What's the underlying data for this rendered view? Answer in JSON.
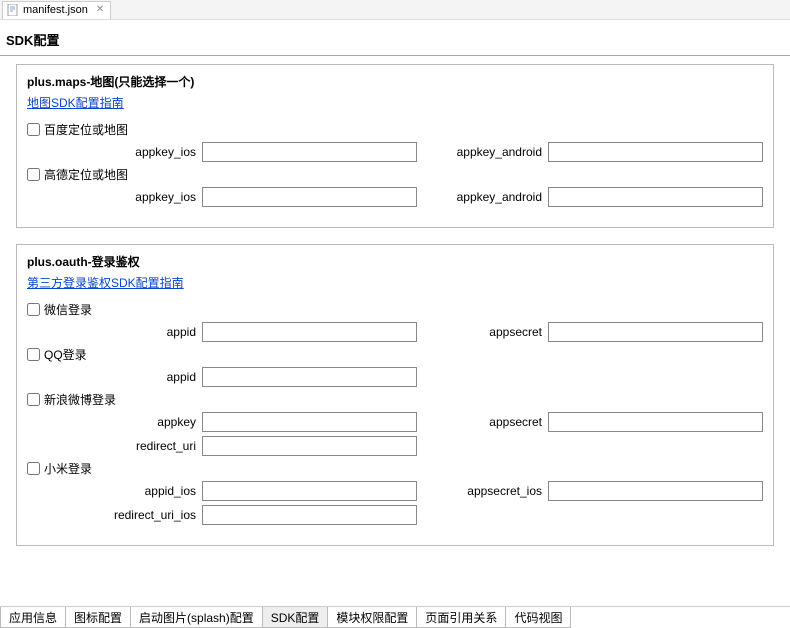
{
  "editor_tab": {
    "label": "manifest.json"
  },
  "page_title": "SDK配置",
  "panels": {
    "maps": {
      "title": "plus.maps-地图(只能选择一个)",
      "guide_link": "地图SDK配置指南",
      "baidu_label": "百度定位或地图",
      "amap_label": "高德定位或地图",
      "fields": {
        "appkey_ios": "appkey_ios",
        "appkey_android": "appkey_android"
      }
    },
    "oauth": {
      "title": "plus.oauth-登录鉴权",
      "guide_link": "第三方登录鉴权SDK配置指南",
      "wechat_label": "微信登录",
      "qq_label": "QQ登录",
      "weibo_label": "新浪微博登录",
      "xiaomi_label": "小米登录",
      "fields": {
        "appid": "appid",
        "appsecret": "appsecret",
        "appkey": "appkey",
        "redirect_uri": "redirect_uri",
        "appid_ios": "appid_ios",
        "appsecret_ios": "appsecret_ios",
        "redirect_uri_ios": "redirect_uri_ios"
      }
    }
  },
  "bottom_tabs": [
    "应用信息",
    "图标配置",
    "启动图片(splash)配置",
    "SDK配置",
    "模块权限配置",
    "页面引用关系",
    "代码视图"
  ],
  "active_bottom_tab": 3
}
